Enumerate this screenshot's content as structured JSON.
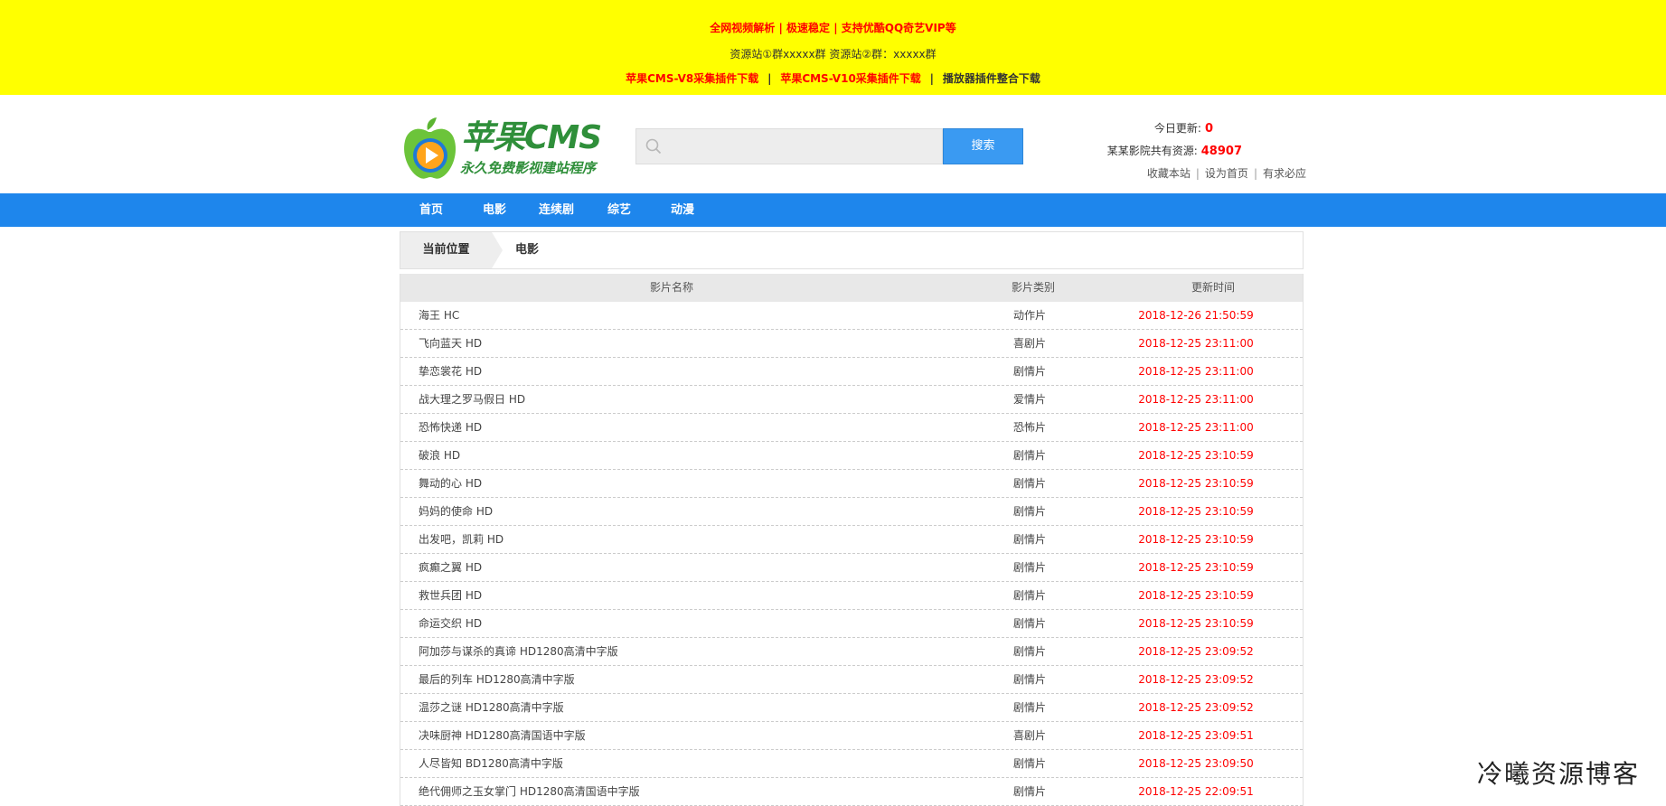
{
  "banner": {
    "line1": "全网视频解析 | 极速稳定 | 支持优酷QQ奇艺VIP等",
    "line2": "资源站①群xxxxx群 资源站②群：xxxxx群",
    "links": [
      "苹果CMS-V8采集插件下载",
      "苹果CMS-V10采集插件下载",
      "播放器插件整合下载"
    ],
    "separator": "|"
  },
  "logo": {
    "title": "苹果CMS",
    "subtitle": "永久免费影视建站程序"
  },
  "search": {
    "placeholder": "",
    "button": "搜索"
  },
  "stats": {
    "today_label": "今日更新:",
    "today_value": "0",
    "total_label": "某某影院共有资源:",
    "total_value": "48907",
    "links": [
      "收藏本站",
      "设为首页",
      "有求必应"
    ]
  },
  "nav": [
    "首页",
    "电影",
    "连续剧",
    "综艺",
    "动漫"
  ],
  "breadcrumb": {
    "label": "当前位置",
    "current": "电影"
  },
  "table": {
    "headers": [
      "影片名称",
      "影片类别",
      "更新时间"
    ],
    "rows": [
      {
        "name": "海王 HC",
        "cat": "动作片",
        "time": "2018-12-26 21:50:59"
      },
      {
        "name": "飞向蓝天 HD",
        "cat": "喜剧片",
        "time": "2018-12-25 23:11:00"
      },
      {
        "name": "挚恋裳花 HD",
        "cat": "剧情片",
        "time": "2018-12-25 23:11:00"
      },
      {
        "name": "战大理之罗马假日 HD",
        "cat": "爱情片",
        "time": "2018-12-25 23:11:00"
      },
      {
        "name": "恐怖快递 HD",
        "cat": "恐怖片",
        "time": "2018-12-25 23:11:00"
      },
      {
        "name": "破浪 HD",
        "cat": "剧情片",
        "time": "2018-12-25 23:10:59"
      },
      {
        "name": "舞动的心 HD",
        "cat": "剧情片",
        "time": "2018-12-25 23:10:59"
      },
      {
        "name": "妈妈的使命 HD",
        "cat": "剧情片",
        "time": "2018-12-25 23:10:59"
      },
      {
        "name": "出发吧，凯莉 HD",
        "cat": "剧情片",
        "time": "2018-12-25 23:10:59"
      },
      {
        "name": "疯癫之翼 HD",
        "cat": "剧情片",
        "time": "2018-12-25 23:10:59"
      },
      {
        "name": "救世兵团 HD",
        "cat": "剧情片",
        "time": "2018-12-25 23:10:59"
      },
      {
        "name": "命运交织 HD",
        "cat": "剧情片",
        "time": "2018-12-25 23:10:59"
      },
      {
        "name": "阿加莎与谋杀的真谛 HD1280高清中字版",
        "cat": "剧情片",
        "time": "2018-12-25 23:09:52"
      },
      {
        "name": "最后的列车 HD1280高清中字版",
        "cat": "剧情片",
        "time": "2018-12-25 23:09:52"
      },
      {
        "name": "温莎之谜 HD1280高清中字版",
        "cat": "剧情片",
        "time": "2018-12-25 23:09:52"
      },
      {
        "name": "决味厨神 HD1280高清国语中字版",
        "cat": "喜剧片",
        "time": "2018-12-25 23:09:51"
      },
      {
        "name": "人尽皆知 BD1280高清中字版",
        "cat": "剧情片",
        "time": "2018-12-25 23:09:50"
      },
      {
        "name": "绝代佣师之玉女掌门 HD1280高清国语中字版",
        "cat": "剧情片",
        "time": "2018-12-25 22:09:51"
      }
    ]
  },
  "watermark": "冷曦资源博客",
  "colors": {
    "banner": "#ffff00",
    "nav": "#1e86ec",
    "search_button": "#3a9af2",
    "accent_red": "#ff0000",
    "logo_green": "#2f8f3a"
  }
}
